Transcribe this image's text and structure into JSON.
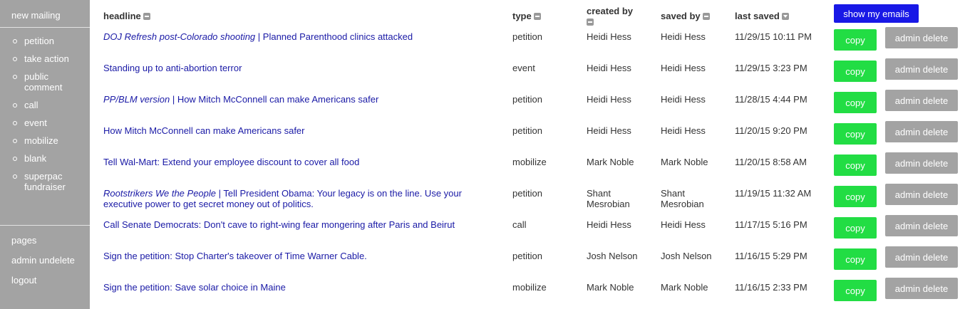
{
  "sidebar": {
    "new_mailing": "new mailing",
    "items": [
      "petition",
      "take action",
      "public comment",
      "call",
      "event",
      "mobilize",
      "blank",
      "superpac fundraiser"
    ],
    "pages": "pages",
    "admin_undelete": "admin undelete",
    "logout": "logout"
  },
  "table": {
    "headers": {
      "headline": "headline",
      "type": "type",
      "created_by": "created by",
      "saved_by": "saved by",
      "last_saved": "last saved"
    },
    "show_my_emails": "show my emails",
    "copy_label": "copy",
    "admin_delete_label": "admin delete",
    "rows": [
      {
        "lead": "DOJ Refresh post-Colorado shooting",
        "sep": " | ",
        "headline": "Planned Parenthood clinics attacked",
        "type": "petition",
        "created_by": "Heidi Hess",
        "saved_by": "Heidi Hess",
        "last_saved": "11/29/15 10:11 PM"
      },
      {
        "lead": "",
        "sep": "",
        "headline": "Standing up to anti-abortion terror",
        "type": "event",
        "created_by": "Heidi Hess",
        "saved_by": "Heidi Hess",
        "last_saved": "11/29/15 3:23 PM"
      },
      {
        "lead": "PP/BLM version",
        "sep": " | ",
        "headline": "How Mitch McConnell can make Americans safer",
        "type": "petition",
        "created_by": "Heidi Hess",
        "saved_by": "Heidi Hess",
        "last_saved": "11/28/15 4:44 PM"
      },
      {
        "lead": "",
        "sep": "",
        "headline": "How Mitch McConnell can make Americans safer",
        "type": "petition",
        "created_by": "Heidi Hess",
        "saved_by": "Heidi Hess",
        "last_saved": "11/20/15 9:20 PM"
      },
      {
        "lead": "",
        "sep": "",
        "headline": "Tell Wal-Mart: Extend your employee discount to cover all food",
        "type": "mobilize",
        "created_by": "Mark Noble",
        "saved_by": "Mark Noble",
        "last_saved": "11/20/15 8:58 AM"
      },
      {
        "lead": "Rootstrikers We the People",
        "sep": " | ",
        "headline": "Tell President Obama: Your legacy is on the line. Use your executive power to get secret money out of politics.",
        "type": "petition",
        "created_by": "Shant Mesrobian",
        "saved_by": "Shant Mesrobian",
        "last_saved": "11/19/15 11:32 AM"
      },
      {
        "lead": "",
        "sep": "",
        "headline": "Call Senate Democrats: Don't cave to right-wing fear mongering after Paris and Beirut",
        "type": "call",
        "created_by": "Heidi Hess",
        "saved_by": "Heidi Hess",
        "last_saved": "11/17/15 5:16 PM"
      },
      {
        "lead": "",
        "sep": "",
        "headline": "Sign the petition: Stop Charter's takeover of Time Warner Cable.",
        "type": "petition",
        "created_by": "Josh Nelson",
        "saved_by": "Josh Nelson",
        "last_saved": "11/16/15 5:29 PM"
      },
      {
        "lead": "",
        "sep": "",
        "headline": "Sign the petition: Save solar choice in Maine",
        "type": "mobilize",
        "created_by": "Mark Noble",
        "saved_by": "Mark Noble",
        "last_saved": "11/16/15 2:33 PM"
      }
    ]
  },
  "colors": {
    "sidebar_bg": "#a3a3a3",
    "link": "#1a1aa6",
    "copy_btn": "#22dd44",
    "admin_delete_btn": "#a3a3a3",
    "show_my_emails_btn": "#1818e6"
  }
}
